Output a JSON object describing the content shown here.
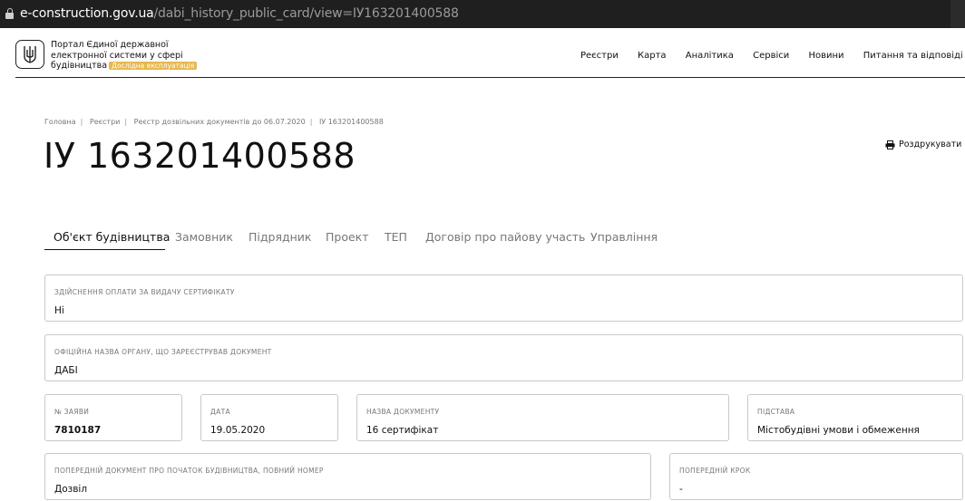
{
  "browser": {
    "url_domain": "e-construction.gov.ua",
    "url_path": "/dabi_history_public_card/view=ІУ163201400588"
  },
  "header": {
    "brand_line1": "Портал Єдиної державної",
    "brand_line2": "електронної системи у сфері",
    "brand_line3": "будівництва",
    "badge": "Дослідна експлуатація",
    "nav": [
      "Реєстри",
      "Карта",
      "Аналітика",
      "Сервіси",
      "Новини",
      "Питання та відповіді"
    ]
  },
  "breadcrumbs": [
    "Головна",
    "Реєстри",
    "Реєстр дозвільних документів до 06.07.2020",
    "ІУ 163201400588"
  ],
  "page_title": "ІУ 163201400588",
  "print_label": "Роздрукувати",
  "tabs": [
    "Об'єкт будівництва",
    "Замовник",
    "Підрядник",
    "Проект",
    "ТЕП",
    "Договір про пайову участь",
    "Управління"
  ],
  "fields": {
    "payment": {
      "label": "ЗДІЙСНЕННЯ ОПЛАТИ ЗА ВИДАЧУ СЕРТИФІКАТУ",
      "value": "Ні"
    },
    "authority": {
      "label": "ОФІЦІЙНА НАЗВА ОРГАНУ, ЩО ЗАРЕЄСТРУВАВ ДОКУМЕНТ",
      "value": "ДАБІ"
    },
    "application_no": {
      "label": "№ ЗАЯВИ",
      "value": "7810187"
    },
    "date": {
      "label": "ДАТА",
      "value": "19.05.2020"
    },
    "doc_name": {
      "label": "НАЗВА ДОКУМЕНТУ",
      "value": "16 сертифікат"
    },
    "basis": {
      "label": "ПІДСТАВА",
      "value": "Містобудівні умови і обмеження"
    },
    "prev_doc": {
      "label": "ПОПЕРЕДНІЙ ДОКУМЕНТ ПРО ПОЧАТОК БУДІВНИЦТВА, ПОВНИЙ НОМЕР",
      "value": "Дозвіл"
    },
    "prev_step": {
      "label": "ПОПЕРЕДНІЙ КРОК",
      "value": "-"
    }
  }
}
